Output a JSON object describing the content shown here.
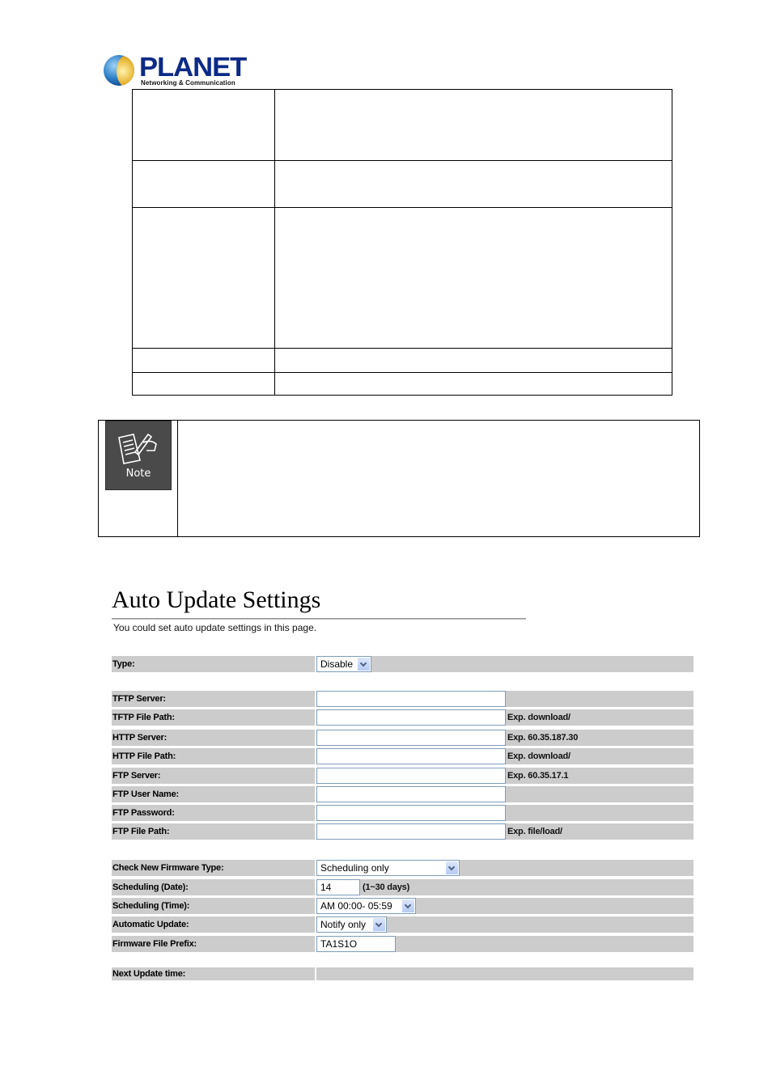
{
  "header": {
    "brand": "PLANET",
    "tagline": "Networking & Communication"
  },
  "note": {
    "icon_label": "Note",
    "icon": "note-pencil-icon"
  },
  "auto_update": {
    "title": "Auto Update Settings",
    "subtitle": "You could set auto update settings in this page.",
    "type": {
      "label": "Type:",
      "value": "Disable"
    },
    "tftp_server": {
      "label": "TFTP Server:",
      "value": "",
      "hint": ""
    },
    "tftp_file_path": {
      "label": "TFTP File Path:",
      "value": "",
      "hint": "Exp. download/"
    },
    "http_server": {
      "label": "HTTP Server:",
      "value": "",
      "hint": "Exp. 60.35.187.30"
    },
    "http_file_path": {
      "label": "HTTP File Path:",
      "value": "",
      "hint": "Exp. download/"
    },
    "ftp_server": {
      "label": "FTP Server:",
      "value": "",
      "hint": "Exp. 60.35.17.1"
    },
    "ftp_user_name": {
      "label": "FTP User Name:",
      "value": "",
      "hint": ""
    },
    "ftp_password": {
      "label": "FTP Password:",
      "value": "",
      "hint": ""
    },
    "ftp_file_path": {
      "label": "FTP File Path:",
      "value": "",
      "hint": "Exp. file/load/"
    },
    "check_firmware_type": {
      "label": "Check New Firmware Type:",
      "value": "Scheduling only"
    },
    "scheduling_date": {
      "label": "Scheduling (Date):",
      "value": "14",
      "hint": "(1~30 days)"
    },
    "scheduling_time": {
      "label": "Scheduling (Time):",
      "value": "AM 00:00- 05:59"
    },
    "automatic_update": {
      "label": "Automatic Update:",
      "value": "Notify only"
    },
    "firmware_prefix": {
      "label": "Firmware File Prefix:",
      "value": "TA1S1O"
    },
    "next_update": {
      "label": "Next Update time:",
      "value": ""
    }
  }
}
